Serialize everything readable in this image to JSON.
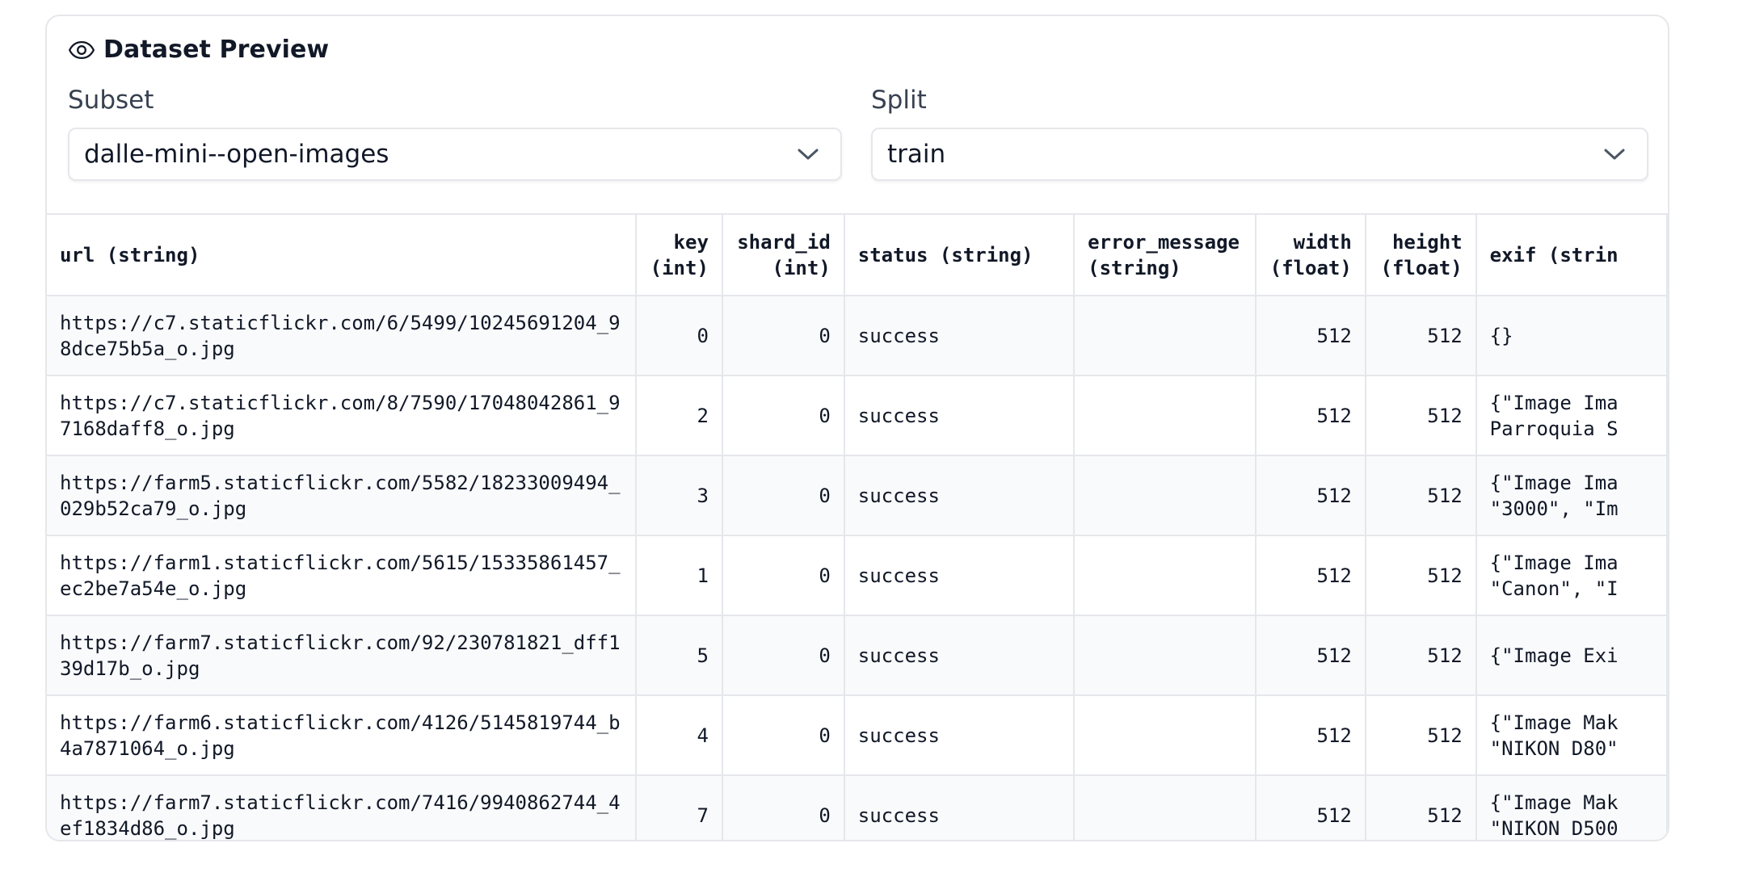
{
  "preview": {
    "title": "Dataset Preview",
    "subset_label": "Subset",
    "subset_value": "dalle-mini--open-images",
    "split_label": "Split",
    "split_value": "train"
  },
  "table": {
    "columns": [
      "url (string)",
      "key\n(int)",
      "shard_id\n(int)",
      "status (string)",
      "error_message\n(string)",
      "width\n(float)",
      "height\n(float)",
      "exif (strin"
    ],
    "rows": [
      {
        "url": "https://c7.staticflickr.com/6/5499/10245691204_98dce75b5a_o.jpg",
        "key": "0",
        "shard_id": "0",
        "status": "success",
        "error_message": "",
        "width": "512",
        "height": "512",
        "exif": "{}"
      },
      {
        "url": "https://c7.staticflickr.com/8/7590/17048042861_97168daff8_o.jpg",
        "key": "2",
        "shard_id": "0",
        "status": "success",
        "error_message": "",
        "width": "512",
        "height": "512",
        "exif": "{\"Image Ima\nParroquia S"
      },
      {
        "url": "https://farm5.staticflickr.com/5582/18233009494_029b52ca79_o.jpg",
        "key": "3",
        "shard_id": "0",
        "status": "success",
        "error_message": "",
        "width": "512",
        "height": "512",
        "exif": "{\"Image Ima\n\"3000\", \"Im"
      },
      {
        "url": "https://farm1.staticflickr.com/5615/15335861457_ec2be7a54e_o.jpg",
        "key": "1",
        "shard_id": "0",
        "status": "success",
        "error_message": "",
        "width": "512",
        "height": "512",
        "exif": "{\"Image Ima\n\"Canon\", \"I"
      },
      {
        "url": "https://farm7.staticflickr.com/92/230781821_dff139d17b_o.jpg",
        "key": "5",
        "shard_id": "0",
        "status": "success",
        "error_message": "",
        "width": "512",
        "height": "512",
        "exif": "{\"Image Exi"
      },
      {
        "url": "https://farm6.staticflickr.com/4126/5145819744_b4a7871064_o.jpg",
        "key": "4",
        "shard_id": "0",
        "status": "success",
        "error_message": "",
        "width": "512",
        "height": "512",
        "exif": "{\"Image Mak\n\"NIKON D80\""
      },
      {
        "url": "https://farm7.staticflickr.com/7416/9940862744_4ef1834d86_o.jpg",
        "key": "7",
        "shard_id": "0",
        "status": "success",
        "error_message": "",
        "width": "512",
        "height": "512",
        "exif": "{\"Image Mak\n\"NIKON D500"
      }
    ]
  }
}
